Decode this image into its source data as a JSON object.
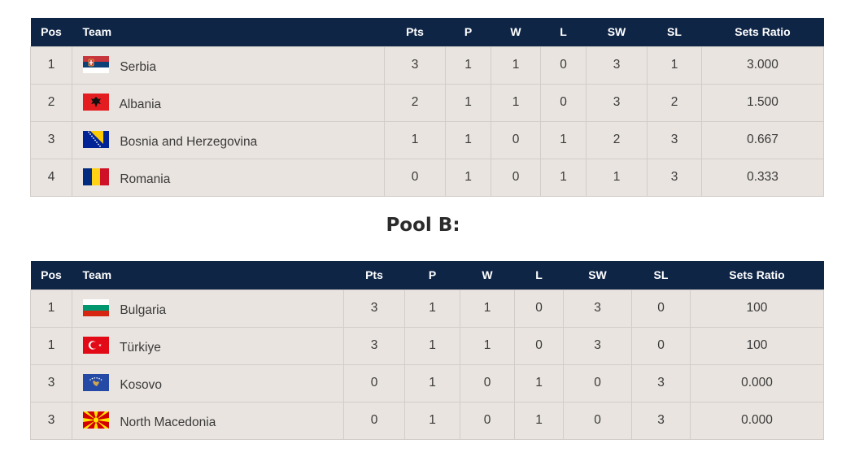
{
  "headers": {
    "pos": "Pos",
    "team": "Team",
    "pts": "Pts",
    "p": "P",
    "w": "W",
    "l": "L",
    "sw": "SW",
    "sl": "SL",
    "sets_ratio": "Sets Ratio"
  },
  "pool_b_title": "Pool B:",
  "pool_a": [
    {
      "pos": "1",
      "team": "Serbia",
      "flag": "serbia-flag-icon",
      "pts": "3",
      "p": "1",
      "w": "1",
      "l": "0",
      "sw": "3",
      "sl": "1",
      "ratio": "3.000"
    },
    {
      "pos": "2",
      "team": "Albania",
      "flag": "albania-flag-icon",
      "pts": "2",
      "p": "1",
      "w": "1",
      "l": "0",
      "sw": "3",
      "sl": "2",
      "ratio": "1.500"
    },
    {
      "pos": "3",
      "team": "Bosnia and Herzegovina",
      "flag": "bosnia-flag-icon",
      "pts": "1",
      "p": "1",
      "w": "0",
      "l": "1",
      "sw": "2",
      "sl": "3",
      "ratio": "0.667"
    },
    {
      "pos": "4",
      "team": "Romania",
      "flag": "romania-flag-icon",
      "pts": "0",
      "p": "1",
      "w": "0",
      "l": "1",
      "sw": "1",
      "sl": "3",
      "ratio": "0.333"
    }
  ],
  "pool_b": [
    {
      "pos": "1",
      "team": "Bulgaria",
      "flag": "bulgaria-flag-icon",
      "pts": "3",
      "p": "1",
      "w": "1",
      "l": "0",
      "sw": "3",
      "sl": "0",
      "ratio": "100"
    },
    {
      "pos": "1",
      "team": "Türkiye",
      "flag": "turkiye-flag-icon",
      "pts": "3",
      "p": "1",
      "w": "1",
      "l": "0",
      "sw": "3",
      "sl": "0",
      "ratio": "100"
    },
    {
      "pos": "3",
      "team": "Kosovo",
      "flag": "kosovo-flag-icon",
      "pts": "0",
      "p": "1",
      "w": "0",
      "l": "1",
      "sw": "0",
      "sl": "3",
      "ratio": "0.000"
    },
    {
      "pos": "3",
      "team": "North Macedonia",
      "flag": "north-macedonia-flag-icon",
      "pts": "0",
      "p": "1",
      "w": "0",
      "l": "1",
      "sw": "0",
      "sl": "3",
      "ratio": "0.000"
    }
  ],
  "colors": {
    "header_bg": "#0f2546",
    "row_bg": "#e9e4df",
    "border": "#d2cdc8"
  }
}
